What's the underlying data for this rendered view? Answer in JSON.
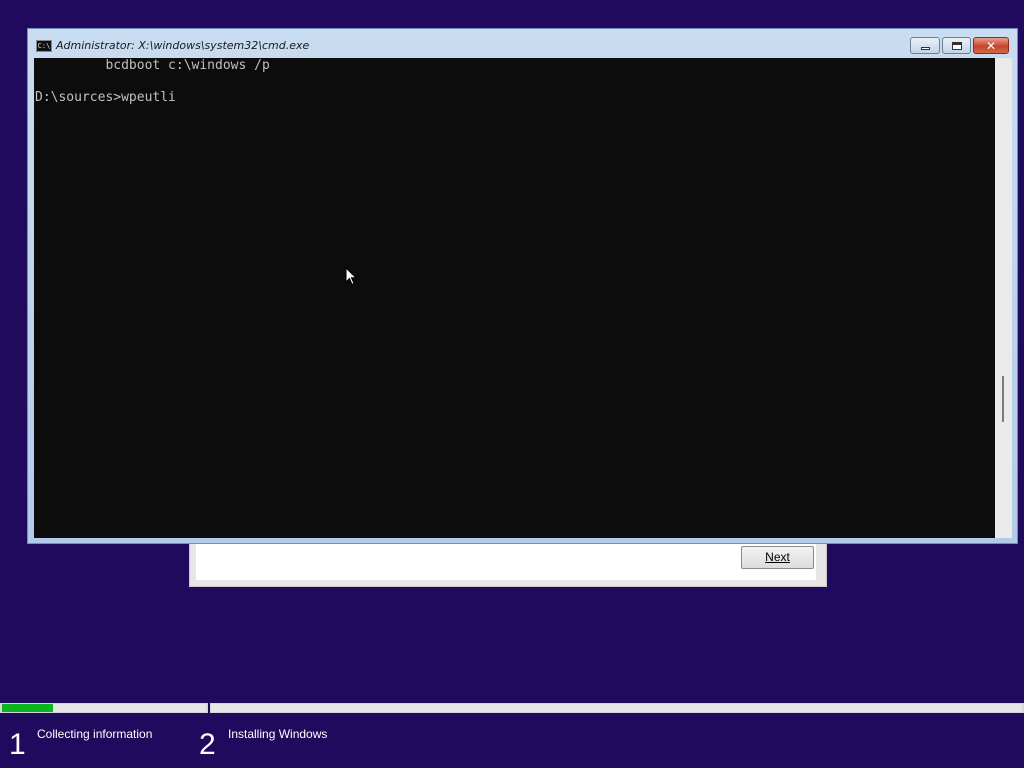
{
  "setup_dialog": {
    "next_label": "Next"
  },
  "cmd_window": {
    "title": "Administrator: X:\\windows\\system32\\cmd.exe",
    "icon": "cmd-icon",
    "icon_text": "C:\\",
    "controls": {
      "minimize": "minimize-icon",
      "maximize": "maximize-icon",
      "close": "close-icon",
      "close_glyph": "✕"
    },
    "console_lines": [
      "         bcdboot c:\\windows /p",
      "D:\\sources>wpeutli"
    ]
  },
  "setup_progress": {
    "steps": [
      {
        "number": "1",
        "label": "Collecting information",
        "progress": 0.25
      },
      {
        "number": "2",
        "label": "Installing Windows",
        "progress": 0.0
      }
    ],
    "colors": {
      "fill": "#0bb520",
      "track": "#e6e6e6",
      "background": "#1f0a5e"
    }
  }
}
